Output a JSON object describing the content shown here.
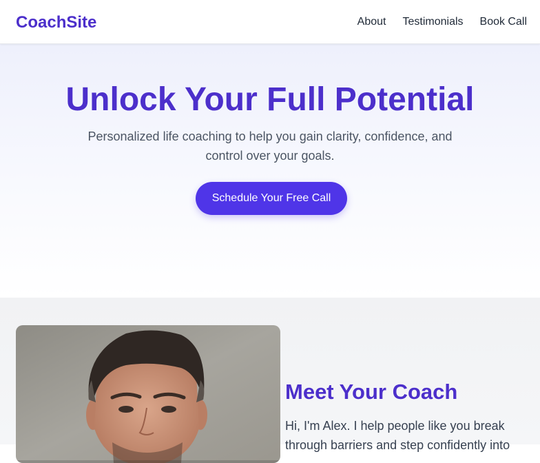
{
  "brand": {
    "logo": "CoachSite",
    "accent": "#4C2FCB",
    "button": "#4F35E8"
  },
  "nav": {
    "items": [
      {
        "label": "About"
      },
      {
        "label": "Testimonials"
      },
      {
        "label": "Book Call"
      }
    ]
  },
  "hero": {
    "title": "Unlock Your Full Potential",
    "subtitle": "Personalized life coaching to help you gain clarity, confidence, and control over your goals.",
    "cta_label": "Schedule Your Free Call"
  },
  "about": {
    "photo": "coach-portrait",
    "title": "Meet Your Coach",
    "text": "Hi, I'm Alex. I help people like you break through barriers and step confidently into"
  }
}
